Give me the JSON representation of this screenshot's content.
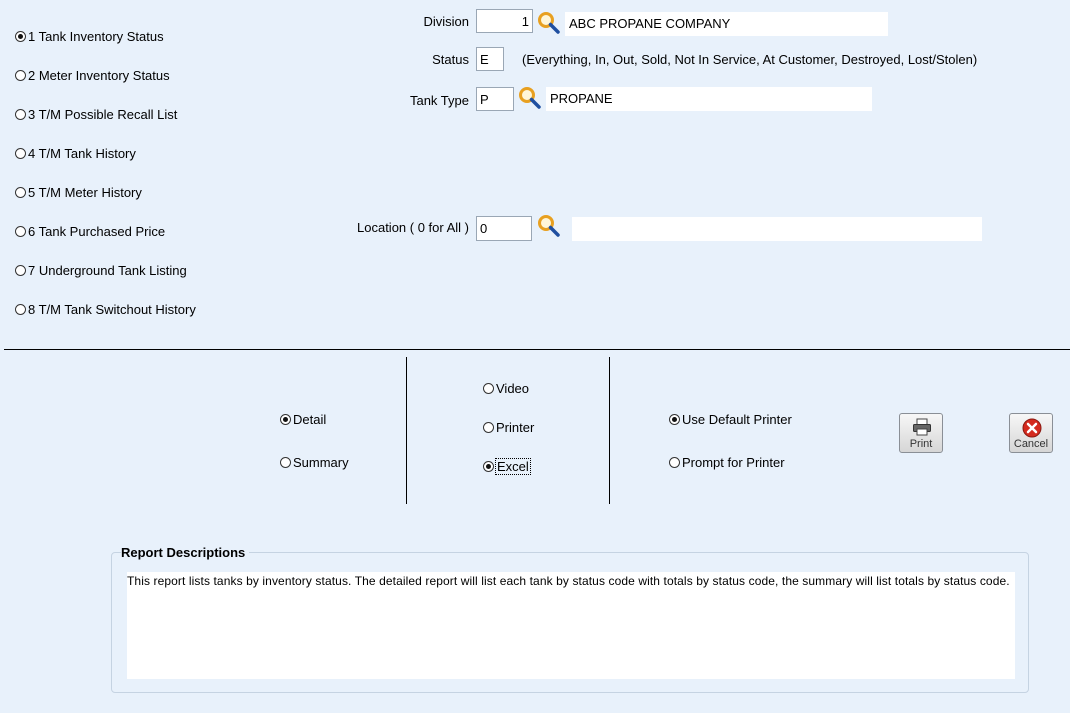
{
  "reports": [
    {
      "label": "1 Tank Inventory Status",
      "selected": true
    },
    {
      "label": "2 Meter Inventory Status",
      "selected": false
    },
    {
      "label": "3 T/M Possible Recall List",
      "selected": false
    },
    {
      "label": "4 T/M Tank History",
      "selected": false
    },
    {
      "label": "5 T/M Meter History",
      "selected": false
    },
    {
      "label": "6 Tank Purchased Price",
      "selected": false
    },
    {
      "label": "7 Underground Tank Listing",
      "selected": false
    },
    {
      "label": "8 T/M Tank Switchout History",
      "selected": false
    }
  ],
  "filters": {
    "division": {
      "label": "Division",
      "value": "1",
      "name": "ABC PROPANE COMPANY"
    },
    "status": {
      "label": "Status",
      "value": "E",
      "hint": "(Everything, In, Out, Sold, Not In Service, At Customer, Destroyed, Lost/Stolen)"
    },
    "tank_type": {
      "label": "Tank Type",
      "value": "P",
      "name": "PROPANE"
    },
    "location": {
      "label": "Location ( 0 for All )",
      "value": "0",
      "name": ""
    }
  },
  "report_type": {
    "detail": {
      "label": "Detail",
      "selected": true
    },
    "summary": {
      "label": "Summary",
      "selected": false
    }
  },
  "output": {
    "video": {
      "label": "Video",
      "selected": false
    },
    "printer": {
      "label": "Printer",
      "selected": false
    },
    "excel": {
      "label": "Excel",
      "selected": true
    }
  },
  "printer_choice": {
    "default": {
      "label": "Use Default Printer",
      "selected": true
    },
    "prompt": {
      "label": "Prompt for Printer",
      "selected": false
    }
  },
  "buttons": {
    "print": "Print",
    "cancel": "Cancel"
  },
  "report_descriptions": {
    "title": "Report Descriptions",
    "text": "This report lists tanks by inventory status. The detailed report will list each tank by status code with totals by status code, the summary will list totals by status code."
  },
  "icons": {
    "lookup": "magnifier-icon",
    "print": "printer-icon",
    "cancel": "cancel-x-icon"
  },
  "colors": {
    "background": "#e8f1fb",
    "cancel_red": "#d42a1e",
    "magnifier_orange": "#e8a020"
  }
}
